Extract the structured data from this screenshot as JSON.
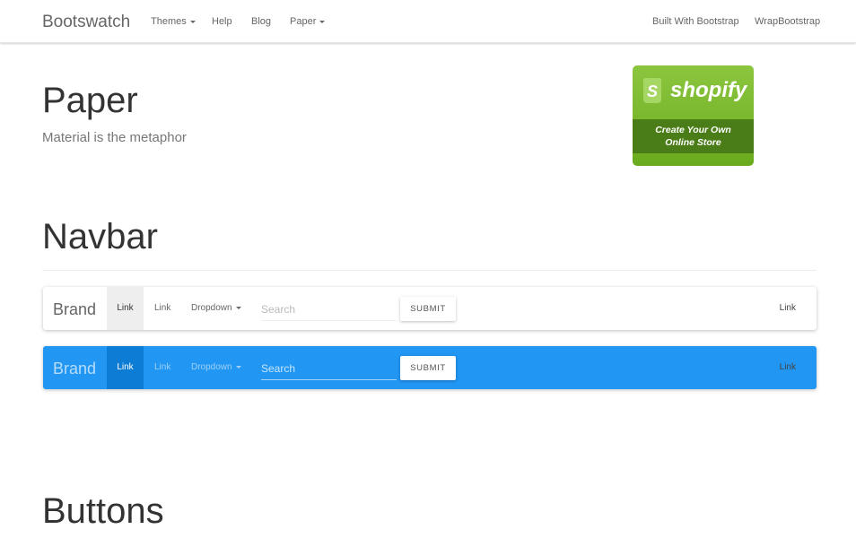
{
  "topbar": {
    "brand": "Bootswatch",
    "nav_left": [
      {
        "label": "Themes",
        "dropdown": true
      },
      {
        "label": "Help",
        "dropdown": false
      },
      {
        "label": "Blog",
        "dropdown": false
      },
      {
        "label": "Paper",
        "dropdown": true
      }
    ],
    "nav_right": [
      {
        "label": "Built With Bootstrap"
      },
      {
        "label": "WrapBootstrap"
      }
    ]
  },
  "header": {
    "title": "Paper",
    "subtitle": "Material is the metaphor"
  },
  "ad": {
    "logo_glyph": "S",
    "brand": "shopify",
    "tagline_line1": "Create Your Own",
    "tagline_line2": "Online Store",
    "colors": {
      "green": "#7bbb2e",
      "band": "#4a7d17"
    }
  },
  "sections": {
    "navbar_heading": "Navbar",
    "buttons_heading": "Buttons"
  },
  "navbar_default": {
    "brand": "Brand",
    "links": [
      "Link",
      "Link"
    ],
    "dropdown": "Dropdown",
    "search_placeholder": "Search",
    "submit": "SUBMIT",
    "right_link": "Link"
  },
  "navbar_inverse": {
    "brand": "Brand",
    "links": [
      "Link",
      "Link"
    ],
    "dropdown": "Dropdown",
    "search_placeholder": "Search",
    "submit": "SUBMIT",
    "right_link": "Link",
    "colors": {
      "background": "#2196f3",
      "active": "#0c7cd5"
    }
  }
}
